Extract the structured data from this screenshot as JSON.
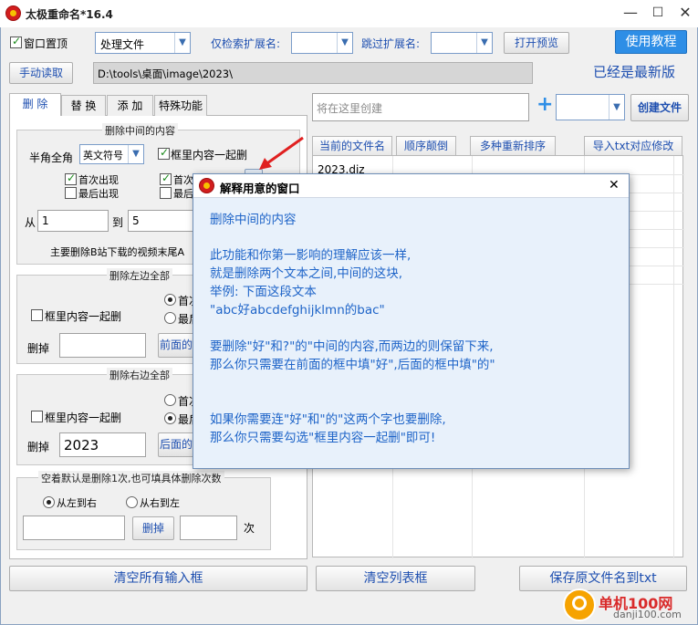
{
  "window": {
    "title": "太极重命名*16.4",
    "minimize": "—",
    "maximize": "☐",
    "close": "✕"
  },
  "toolbar": {
    "pin_label": "窗口置顶",
    "mode_value": "处理文件",
    "only_ext_label": "仅检索扩展名:",
    "skip_ext_label": "跳过扩展名:",
    "preview_button": "打开预览",
    "tutorial_button": "使用教程",
    "manual_read_button": "手动读取",
    "path_value": "D:\\tools\\桌面\\image\\2023\\",
    "update_status": "已经是最新版"
  },
  "tabs": [
    "删 除",
    "替 换",
    "添 加",
    "特殊功能"
  ],
  "delete_middle": {
    "title": "删除中间的内容",
    "width_label": "半角全角",
    "width_value": "英文符号",
    "together_label": "框里内容一起删",
    "first_occur": "首次出现",
    "last_occur": "最后出现",
    "first_occur_2": "首次",
    "last_occur_2": "最后",
    "from_label": "从",
    "from_value": "1",
    "to_label": "到",
    "to_value": "5",
    "note": "主要删除B站下载的视频末尾A"
  },
  "delete_left": {
    "title": "删除左边全部",
    "together_label": "框里内容一起删",
    "first_opt": "首次",
    "last_opt": "最后",
    "delete_label": "删掉",
    "delete_value": "",
    "front_btn": "前面的"
  },
  "delete_right": {
    "title": "删除右边全部",
    "together_label": "框里内容一起删",
    "first_opt": "首次",
    "last_opt": "最后",
    "delete_label": "删掉",
    "delete_value": "2023",
    "front_btn": "后面的"
  },
  "delete_count": {
    "title": "空着默认是删除1次,也可填具体删除次数",
    "left_to_right": "从左到右",
    "right_to_left": "从右到左",
    "delete_btn": "删掉",
    "times_label": "次"
  },
  "right_panel": {
    "create_placeholder": "将在这里创建",
    "plus": "+",
    "create_file_button": "创建文件",
    "headers": [
      "当前的文件名",
      "顺序颠倒",
      "多种重新排序",
      "导入txt对应修改"
    ],
    "rows": [
      "2023.diz"
    ]
  },
  "bottom": {
    "clear_inputs": "清空所有输入框",
    "clear_list": "清空列表框",
    "save_names": "保存原文件名到txt"
  },
  "popup": {
    "title": "解释用意的窗口",
    "close": "✕",
    "lines": [
      "删除中间的内容",
      "",
      "此功能和你第一影响的理解应该一样,",
      "就是删除两个文本之间,中间的这块,",
      "举例: 下面这段文本",
      "\"abc好abcdefghijklmn的bac\"",
      "",
      "要删除\"好\"和?\"的\"中间的内容,而两边的则保留下来,",
      "那么你只需要在前面的框中填\"好\",后面的框中填\"的\"",
      "",
      "",
      "如果你需要连\"好\"和\"的\"这两个字也要删除,",
      "那么你只需要勾选\"框里内容一起删\"即可!"
    ]
  },
  "watermark": {
    "text": "单机100网",
    "url": "danji100.com"
  },
  "colors": {
    "accent_blue": "#1e4fb0",
    "popup_text": "#1e64c8",
    "tutorial_button_bg": "#2e8ee6",
    "arrow_red": "#e02020"
  }
}
